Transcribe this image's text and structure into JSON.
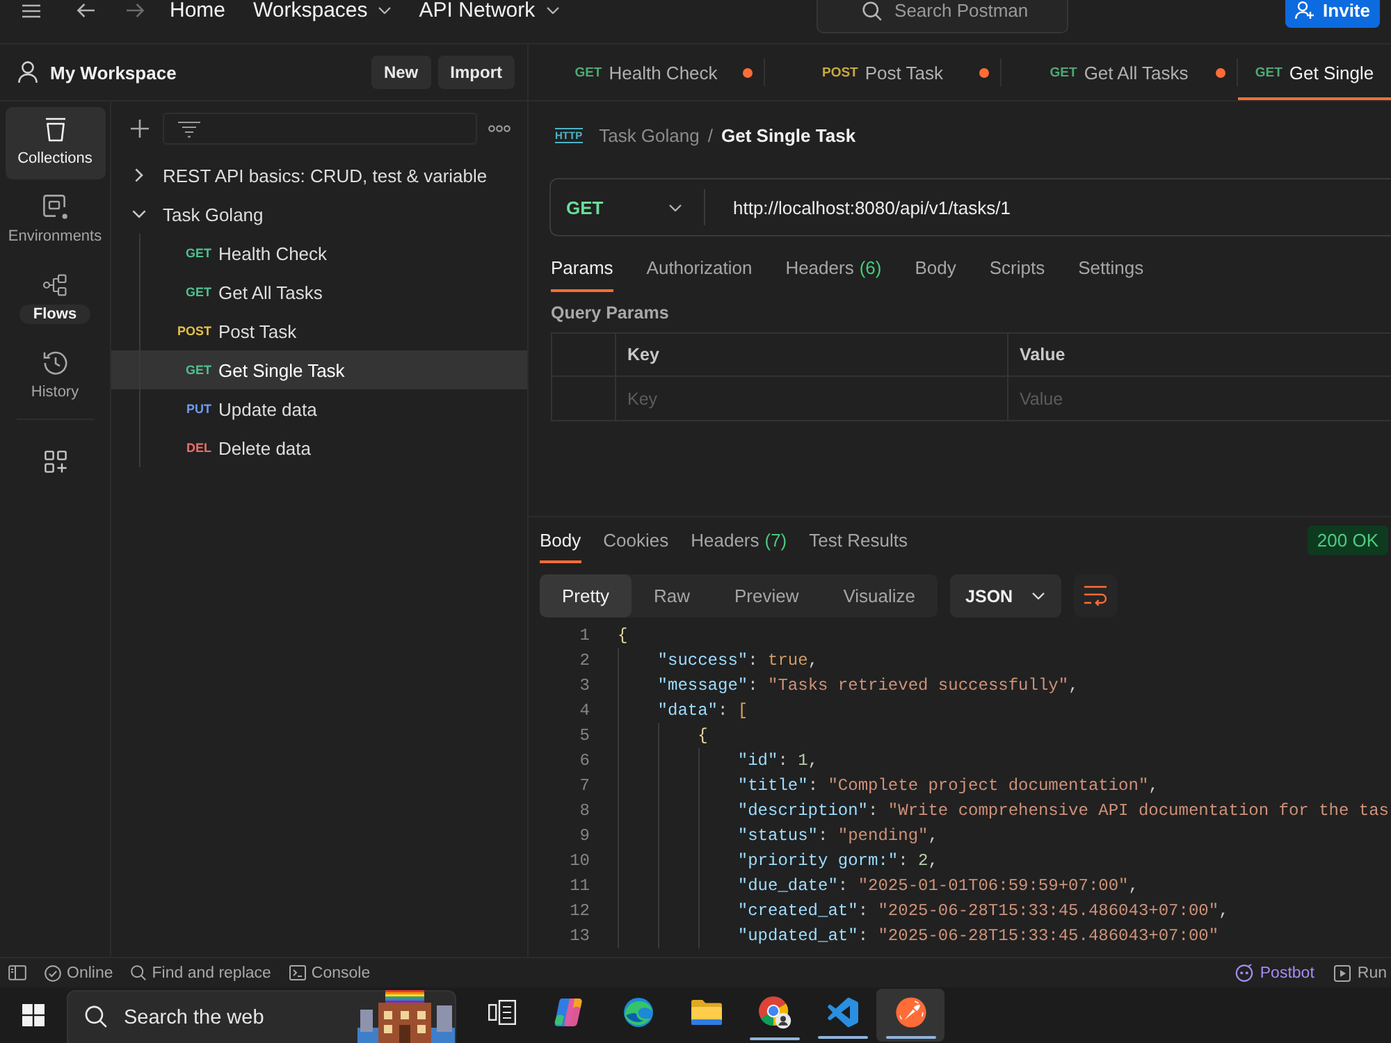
{
  "header": {
    "nav": [
      {
        "label": "Home",
        "dropdown": false
      },
      {
        "label": "Workspaces",
        "dropdown": true
      },
      {
        "label": "API Network",
        "dropdown": true
      }
    ],
    "search": {
      "placeholder": "Search Postman"
    },
    "invite": "Invite"
  },
  "workspace": {
    "title": "My Workspace",
    "buttons": [
      "New",
      "Import"
    ]
  },
  "request_tabs": [
    {
      "method": "GET",
      "color": "#4fa874",
      "name": "Health Check",
      "unsaved": true,
      "selected": false
    },
    {
      "method": "POST",
      "color": "#c9a93f",
      "name": "Post Task",
      "unsaved": true,
      "selected": false
    },
    {
      "method": "GET",
      "color": "#4fa874",
      "name": "Get All Tasks",
      "unsaved": true,
      "selected": false
    },
    {
      "method": "GET",
      "color": "#4fa874",
      "name": "Get Single",
      "unsaved": false,
      "selected": true
    }
  ],
  "nav_rail": [
    {
      "label": "Collections",
      "selected": true,
      "emphasized": false
    },
    {
      "label": "Environments",
      "selected": false,
      "emphasized": false
    },
    {
      "label": "Flows",
      "selected": false,
      "emphasized": true
    },
    {
      "label": "History",
      "selected": false,
      "emphasized": false
    }
  ],
  "collections": {
    "tree": [
      {
        "kind": "collection",
        "name": "REST API basics: CRUD, test & variable",
        "expanded": false,
        "selected": false
      },
      {
        "kind": "collection",
        "name": "Task Golang",
        "expanded": true,
        "selected": false,
        "children": [
          {
            "kind": "request",
            "method": "GET",
            "color": "#4fc08d",
            "name": "Health Check",
            "selected": false
          },
          {
            "kind": "request",
            "method": "GET",
            "color": "#4fc08d",
            "name": "Get All Tasks",
            "selected": false
          },
          {
            "kind": "request",
            "method": "POST",
            "color": "#e3c04b",
            "name": "Post Task",
            "selected": false
          },
          {
            "kind": "request",
            "method": "GET",
            "color": "#4fc08d",
            "name": "Get Single Task",
            "selected": true
          },
          {
            "kind": "request",
            "method": "PUT",
            "color": "#6b9cf0",
            "name": "Update data",
            "selected": false
          },
          {
            "kind": "request",
            "method": "DEL",
            "color": "#e8706a",
            "name": "Delete data",
            "selected": false
          }
        ]
      }
    ]
  },
  "request": {
    "type_label": "HTTP",
    "breadcrumb": {
      "parent": "Task Golang",
      "separator": "/",
      "name": "Get Single Task"
    },
    "method": "GET",
    "url": "http://localhost:8080/api/v1/tasks/1",
    "tabs": [
      {
        "label": "Params",
        "selected": true
      },
      {
        "label": "Authorization",
        "selected": false
      },
      {
        "label": "Headers",
        "count": "(6)",
        "selected": false
      },
      {
        "label": "Body",
        "selected": false
      },
      {
        "label": "Scripts",
        "selected": false
      },
      {
        "label": "Settings",
        "selected": false
      }
    ],
    "query_params": {
      "title": "Query Params",
      "columns": [
        "Key",
        "Value"
      ],
      "row": {
        "key": {
          "placeholder": "Key"
        },
        "value": {
          "placeholder": "Value"
        }
      }
    }
  },
  "response": {
    "tabs": [
      {
        "label": "Body",
        "selected": true
      },
      {
        "label": "Cookies",
        "selected": false
      },
      {
        "label": "Headers",
        "count": "(7)",
        "selected": false
      },
      {
        "label": "Test Results",
        "selected": false
      }
    ],
    "status": "200 OK",
    "views": [
      {
        "label": "Pretty",
        "selected": true
      },
      {
        "label": "Raw",
        "selected": false
      },
      {
        "label": "Preview",
        "selected": false
      },
      {
        "label": "Visualize",
        "selected": false
      }
    ],
    "format": "JSON",
    "code": [
      {
        "number": "1",
        "tokens": [
          {
            "kind": "brace",
            "text": "{"
          }
        ],
        "children": [
          {
            "number": "2",
            "tokens": [
              {
                "kind": "key",
                "text": "\"success\""
              },
              {
                "kind": "punct",
                "text": ": "
              },
              {
                "kind": "literal",
                "text": "true"
              },
              {
                "kind": "punct",
                "text": ","
              }
            ]
          },
          {
            "number": "3",
            "tokens": [
              {
                "kind": "key",
                "text": "\"message\""
              },
              {
                "kind": "punct",
                "text": ": "
              },
              {
                "kind": "string",
                "text": "\"Tasks retrieved successfully\""
              },
              {
                "kind": "punct",
                "text": ","
              }
            ]
          },
          {
            "number": "4",
            "tokens": [
              {
                "kind": "key",
                "text": "\"data\""
              },
              {
                "kind": "punct",
                "text": ": "
              },
              {
                "kind": "bracket",
                "text": "["
              }
            ],
            "children": [
              {
                "number": "5",
                "tokens": [
                  {
                    "kind": "brace",
                    "text": "{"
                  }
                ],
                "children": [
                  {
                    "number": "6",
                    "tokens": [
                      {
                        "kind": "key",
                        "text": "\"id\""
                      },
                      {
                        "kind": "punct",
                        "text": ": "
                      },
                      {
                        "kind": "number",
                        "text": "1"
                      },
                      {
                        "kind": "punct",
                        "text": ","
                      }
                    ]
                  },
                  {
                    "number": "7",
                    "tokens": [
                      {
                        "kind": "key",
                        "text": "\"title\""
                      },
                      {
                        "kind": "punct",
                        "text": ": "
                      },
                      {
                        "kind": "string",
                        "text": "\"Complete project documentation\""
                      },
                      {
                        "kind": "punct",
                        "text": ","
                      }
                    ]
                  },
                  {
                    "number": "8",
                    "tokens": [
                      {
                        "kind": "key",
                        "text": "\"description\""
                      },
                      {
                        "kind": "punct",
                        "text": ": "
                      },
                      {
                        "kind": "string",
                        "text": "\"Write comprehensive API documentation for the tas"
                      }
                    ]
                  },
                  {
                    "number": "9",
                    "tokens": [
                      {
                        "kind": "key",
                        "text": "\"status\""
                      },
                      {
                        "kind": "punct",
                        "text": ": "
                      },
                      {
                        "kind": "string",
                        "text": "\"pending\""
                      },
                      {
                        "kind": "punct",
                        "text": ","
                      }
                    ]
                  },
                  {
                    "number": "10",
                    "tokens": [
                      {
                        "kind": "key",
                        "text": "\"priority gorm:\""
                      },
                      {
                        "kind": "punct",
                        "text": ": "
                      },
                      {
                        "kind": "number",
                        "text": "2"
                      },
                      {
                        "kind": "punct",
                        "text": ","
                      }
                    ]
                  },
                  {
                    "number": "11",
                    "tokens": [
                      {
                        "kind": "key",
                        "text": "\"due_date\""
                      },
                      {
                        "kind": "punct",
                        "text": ": "
                      },
                      {
                        "kind": "string",
                        "text": "\"2025-01-01T06:59:59+07:00\""
                      },
                      {
                        "kind": "punct",
                        "text": ","
                      }
                    ]
                  },
                  {
                    "number": "12",
                    "tokens": [
                      {
                        "kind": "key",
                        "text": "\"created_at\""
                      },
                      {
                        "kind": "punct",
                        "text": ": "
                      },
                      {
                        "kind": "string",
                        "text": "\"2025-06-28T15:33:45.486043+07:00\""
                      },
                      {
                        "kind": "punct",
                        "text": ","
                      }
                    ]
                  },
                  {
                    "number": "13",
                    "tokens": [
                      {
                        "kind": "key",
                        "text": "\"updated_at\""
                      },
                      {
                        "kind": "punct",
                        "text": ": "
                      },
                      {
                        "kind": "string",
                        "text": "\"2025-06-28T15:33:45.486043+07:00\""
                      }
                    ]
                  }
                ]
              }
            ]
          }
        ]
      }
    ]
  },
  "status_bar": {
    "left": [
      "Online",
      "Find and replace",
      "Console"
    ],
    "right": [
      {
        "label": "Postbot",
        "accent": true
      },
      {
        "label": "Run",
        "accent": false
      }
    ]
  },
  "taskbar": {
    "search": {
      "placeholder": "Search the web"
    },
    "apps": [
      {
        "running": false,
        "selected": false
      },
      {
        "running": false,
        "selected": false
      },
      {
        "running": false,
        "selected": false
      },
      {
        "running": true,
        "selected": false
      },
      {
        "running": true,
        "selected": false
      },
      {
        "running": true,
        "selected": true
      }
    ]
  }
}
